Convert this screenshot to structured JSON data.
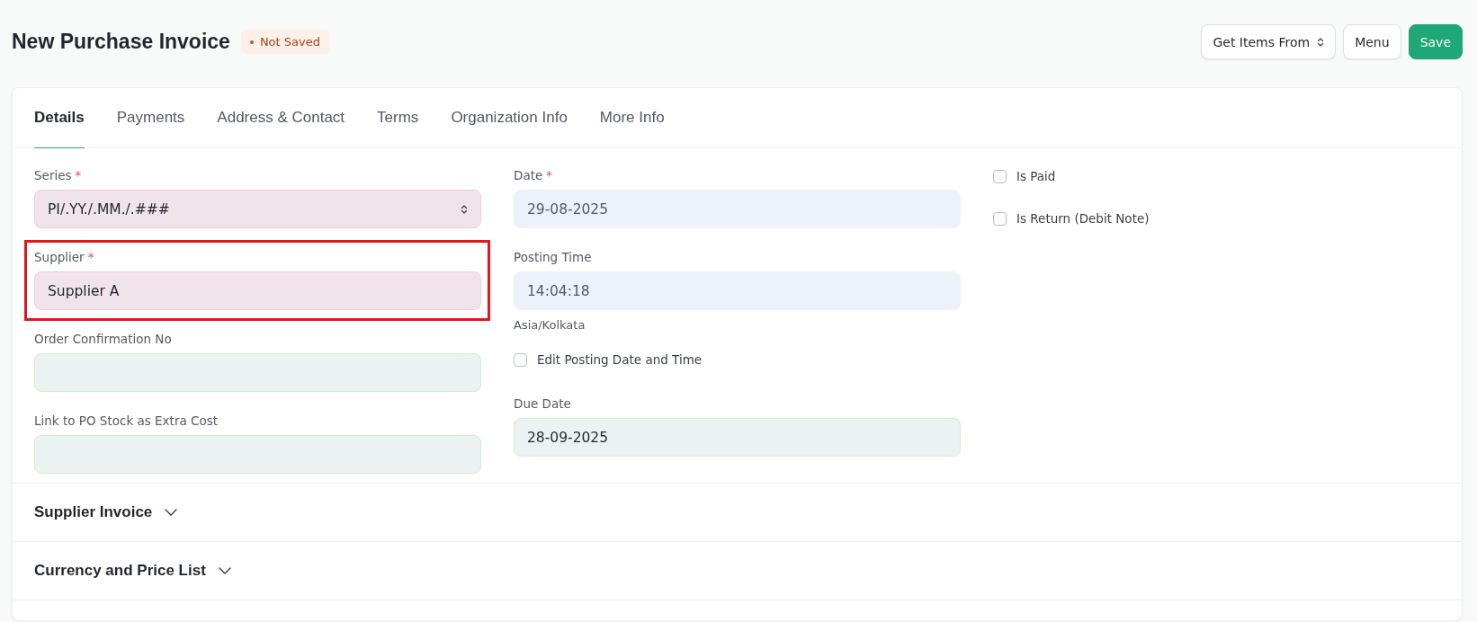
{
  "page": {
    "title": "New Purchase Invoice",
    "status": "Not Saved"
  },
  "actions": [
    {
      "label": "Get Items From",
      "kind": "dropdown"
    },
    {
      "label": "Menu",
      "kind": "default"
    },
    {
      "label": "Save",
      "kind": "primary"
    }
  ],
  "tabs": [
    {
      "label": "Details",
      "selected": true
    },
    {
      "label": "Payments",
      "selected": false
    },
    {
      "label": "Address & Contact",
      "selected": false
    },
    {
      "label": "Terms",
      "selected": false
    },
    {
      "label": "Organization Info",
      "selected": false
    },
    {
      "label": "More Info",
      "selected": false
    }
  ],
  "columns": [
    {
      "items": [
        {
          "kind": "select",
          "label": "Series",
          "required_mark": "*",
          "value": "PI/.YY./.MM./.###",
          "required": true,
          "highlighted": false
        },
        {
          "kind": "input",
          "label": "Supplier",
          "required_mark": "*",
          "value": "Supplier A",
          "required": true,
          "highlighted": true
        },
        {
          "kind": "input",
          "label": "Order Confirmation No",
          "required": false,
          "read_only": false,
          "highlighted": false
        },
        {
          "kind": "input",
          "label": "Link to PO Stock as Extra Cost",
          "required": false,
          "read_only": false,
          "highlighted": false
        }
      ]
    },
    {
      "items": [
        {
          "kind": "input",
          "label": "Date",
          "required_mark": "*",
          "value": "29-08-2025",
          "required": false,
          "read_only": true,
          "highlighted": false
        },
        {
          "kind": "input",
          "label": "Posting Time",
          "value": "14:04:18",
          "required": false,
          "read_only": true,
          "description": "Asia/Kolkata",
          "highlighted": false
        },
        {
          "kind": "checkbox",
          "label": "Edit Posting Date and Time",
          "checked": false
        },
        {
          "kind": "input",
          "label": "Due Date",
          "value": "28-09-2025",
          "required": false,
          "read_only": false,
          "highlighted": false
        }
      ]
    },
    {
      "items": [
        {
          "kind": "checkbox",
          "label": "Is Paid",
          "checked": false
        },
        {
          "kind": "checkbox",
          "label": "Is Return (Debit Note)",
          "checked": false
        }
      ]
    }
  ],
  "sections": [
    {
      "title": "Supplier Invoice",
      "expanded": false
    },
    {
      "title": "Currency and Price List",
      "expanded": false
    }
  ]
}
